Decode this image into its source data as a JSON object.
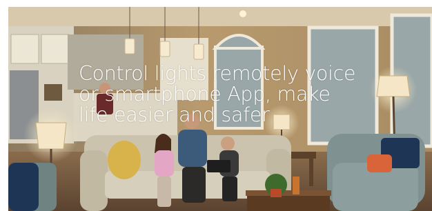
{
  "slide": {
    "headline_lines": [
      "Control lights remotely voice",
      "or smartphone App, make",
      "life easier and safer"
    ]
  },
  "scene": {
    "description_icon": "living-room-photo",
    "colors": {
      "wall": "#b89a6e",
      "ceiling": "#d8c8ac",
      "sofa": "#cbc3ae",
      "chair": "#7f9191",
      "window_glass": "#9aa7a8",
      "lamp_glow": "#f3e4c1",
      "floor": "#8a6c4c"
    }
  }
}
